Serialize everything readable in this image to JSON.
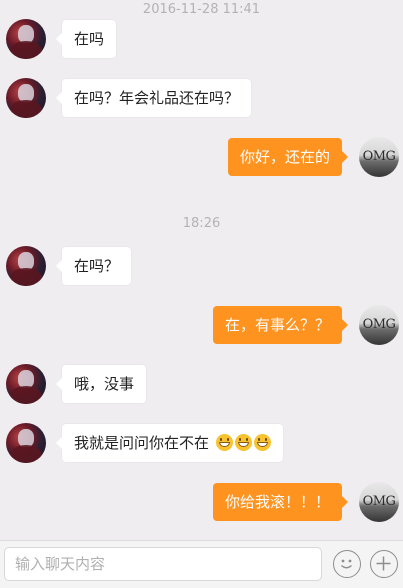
{
  "chat": {
    "timestamp_top": "2016-11-28 11:41",
    "timestamp_mid": "18:26",
    "messages": [
      {
        "side": "left",
        "text": "在吗"
      },
      {
        "side": "left",
        "text": "在吗？年会礼品还在吗？"
      },
      {
        "side": "right",
        "text": "你好，还在的"
      },
      {
        "side": "left",
        "text": "在吗？"
      },
      {
        "side": "right",
        "text": "在，有事么？？"
      },
      {
        "side": "left",
        "text": "哦，没事"
      },
      {
        "side": "left",
        "text": "我就是问问你在不在",
        "emoji": "grinning-face-emoji x3"
      },
      {
        "side": "right",
        "text": "你给我滚！！！"
      }
    ],
    "self_avatar_text": "OMG"
  },
  "input": {
    "placeholder": "输入聊天内容",
    "emoji_icon": "smiley-icon",
    "plus_icon": "plus-icon"
  }
}
